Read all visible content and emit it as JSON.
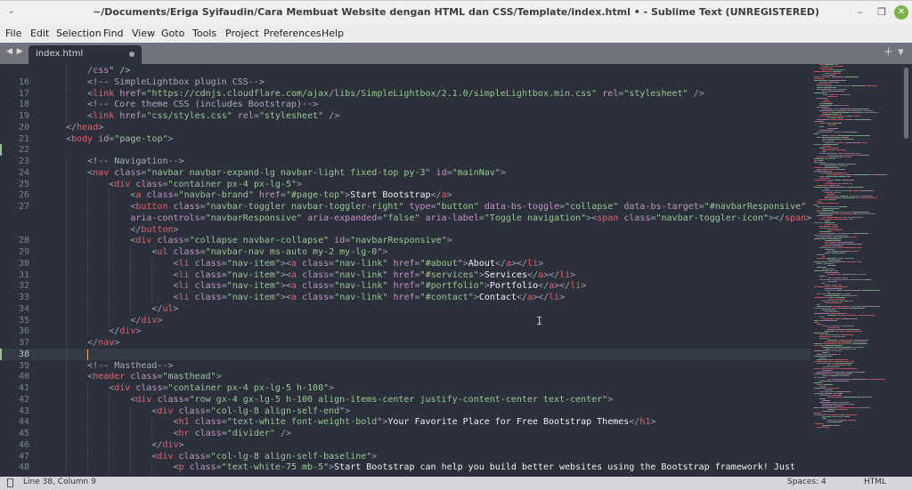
{
  "window": {
    "title": "~/Documents/Eriga Syifaudin/Cara Membuat Website dengan HTML dan CSS/Template/index.html • - Sublime Text (UNREGISTERED)",
    "menu_icon": "chevron-down-icon",
    "minimize": "–",
    "restore": "❐",
    "close": "✕"
  },
  "menubar": [
    "File",
    "Edit",
    "Selection",
    "Find",
    "View",
    "Goto",
    "Tools",
    "Project",
    "Preferences",
    "Help"
  ],
  "tabs": {
    "nav": "◀ ▶",
    "active": {
      "label": "index.html",
      "dirty": true
    },
    "new_tab": "+",
    "tab_menu": "▼"
  },
  "editor": {
    "cursor": {
      "line": 38,
      "column": 9
    },
    "modified_lines": [
      22,
      38
    ],
    "colors": {
      "background": "#2b303b",
      "tag": "#ec5f67",
      "attribute": "#c594c5",
      "string": "#99c794",
      "comment": "#a7adba",
      "text": "#eef0f3"
    },
    "rows": [
      {
        "n": "",
        "i": 2,
        "t": "/css\" />",
        "cont": true
      },
      {
        "n": "16",
        "i": 2,
        "t": "<!-- SimpleLightbox plugin CSS-->"
      },
      {
        "n": "17",
        "i": 2,
        "t": "<link href=\"https://cdnjs.cloudflare.com/ajax/libs/SimpleLightbox/2.1.0/simpleLightbox.min.css\" rel=\"stylesheet\" />"
      },
      {
        "n": "18",
        "i": 2,
        "t": "<!-- Core theme CSS (includes Bootstrap)-->"
      },
      {
        "n": "19",
        "i": 2,
        "t": "<link href=\"css/styles.css\" rel=\"stylesheet\" />"
      },
      {
        "n": "20",
        "i": 1,
        "t": "</head>"
      },
      {
        "n": "21",
        "i": 1,
        "t": "<body id=\"page-top\">"
      },
      {
        "n": "22",
        "i": 0,
        "t": ""
      },
      {
        "n": "23",
        "i": 2,
        "t": "<!-- Navigation-->"
      },
      {
        "n": "24",
        "i": 2,
        "t": "<nav class=\"navbar navbar-expand-lg navbar-light fixed-top py-3\" id=\"mainNav\">"
      },
      {
        "n": "25",
        "i": 3,
        "t": "<div class=\"container px-4 px-lg-5\">"
      },
      {
        "n": "26",
        "i": 4,
        "t": "<a class=\"navbar-brand\" href=\"#page-top\">Start Bootstrap</a>"
      },
      {
        "n": "27",
        "i": 4,
        "t": "<button class=\"navbar-toggler navbar-toggler-right\" type=\"button\" data-bs-toggle=\"collapse\" data-bs-target=\"#navbarResponsive\""
      },
      {
        "n": "",
        "i": 4,
        "t": "aria-controls=\"navbarResponsive\" aria-expanded=\"false\" aria-label=\"Toggle navigation\"><span class=\"navbar-toggler-icon\"></span>",
        "cont": true
      },
      {
        "n": "",
        "i": 4,
        "t": "</button>"
      },
      {
        "n": "28",
        "i": 4,
        "t": "<div class=\"collapse navbar-collapse\" id=\"navbarResponsive\">"
      },
      {
        "n": "29",
        "i": 5,
        "t": "<ul class=\"navbar-nav ms-auto my-2 my-lg-0\">"
      },
      {
        "n": "30",
        "i": 6,
        "t": "<li class=\"nav-item\"><a class=\"nav-link\" href=\"#about\">About</a></li>"
      },
      {
        "n": "31",
        "i": 6,
        "t": "<li class=\"nav-item\"><a class=\"nav-link\" href=\"#services\">Services</a></li>"
      },
      {
        "n": "32",
        "i": 6,
        "t": "<li class=\"nav-item\"><a class=\"nav-link\" href=\"#portfolio\">Portfolio</a></li>"
      },
      {
        "n": "33",
        "i": 6,
        "t": "<li class=\"nav-item\"><a class=\"nav-link\" href=\"#contact\">Contact</a></li>"
      },
      {
        "n": "34",
        "i": 5,
        "t": "</ul>"
      },
      {
        "n": "35",
        "i": 4,
        "t": "</div>"
      },
      {
        "n": "36",
        "i": 3,
        "t": "</div>"
      },
      {
        "n": "37",
        "i": 2,
        "t": "</nav>"
      },
      {
        "n": "38",
        "i": 2,
        "t": ""
      },
      {
        "n": "39",
        "i": 2,
        "t": "<!-- Masthead-->"
      },
      {
        "n": "40",
        "i": 2,
        "t": "<header class=\"masthead\">"
      },
      {
        "n": "41",
        "i": 3,
        "t": "<div class=\"container px-4 px-lg-5 h-100\">"
      },
      {
        "n": "42",
        "i": 4,
        "t": "<div class=\"row gx-4 gx-lg-5 h-100 align-items-center justify-content-center text-center\">"
      },
      {
        "n": "43",
        "i": 5,
        "t": "<div class=\"col-lg-8 align-self-end\">"
      },
      {
        "n": "44",
        "i": 6,
        "t": "<h1 class=\"text-white font-weight-bold\">Your Favorite Place for Free Bootstrap Themes</h1>"
      },
      {
        "n": "45",
        "i": 6,
        "t": "<hr class=\"divider\" />"
      },
      {
        "n": "46",
        "i": 5,
        "t": "</div>"
      },
      {
        "n": "47",
        "i": 5,
        "t": "<div class=\"col-lg-8 align-self-baseline\">"
      },
      {
        "n": "48",
        "i": 6,
        "t": "<p class=\"text-white-75 mb-5\">Start Bootstrap can help you build better websites using the Bootstrap framework! Just"
      }
    ]
  },
  "statusbar": {
    "position": "Line 38, Column 9",
    "spaces": "Spaces: 4",
    "syntax": "HTML"
  }
}
